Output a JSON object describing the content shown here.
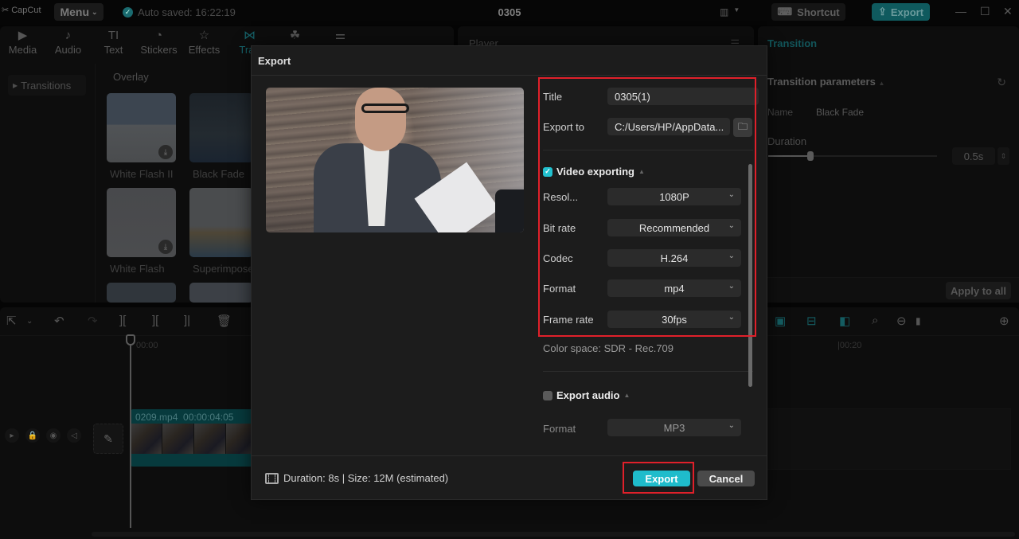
{
  "app": {
    "logo": "CapCut",
    "menu_label": "Menu",
    "autosave": "Auto saved: 16:22:19",
    "project_title": "0305",
    "shortcut_label": "Shortcut",
    "export_label": "Export",
    "accent_color": "#1fbccb"
  },
  "tool_tabs": [
    {
      "label": "Media",
      "icon": "media-icon"
    },
    {
      "label": "Audio",
      "icon": "audio-icon"
    },
    {
      "label": "Text",
      "icon": "text-icon"
    },
    {
      "label": "Stickers",
      "icon": "stickers-icon"
    },
    {
      "label": "Effects",
      "icon": "effects-icon"
    },
    {
      "label": "Tran",
      "icon": "transitions-icon",
      "active": true
    },
    {
      "label": "",
      "icon": "filters-icon"
    },
    {
      "label": "",
      "icon": "adjustment-icon"
    }
  ],
  "sidebar": {
    "item": "Transitions"
  },
  "library": {
    "section": "Overlay",
    "items": [
      {
        "label": "White Flash II"
      },
      {
        "label": "Black Fade"
      },
      {
        "label": "White Flash"
      },
      {
        "label": "Superimpose"
      }
    ]
  },
  "player": {
    "label": "Player"
  },
  "properties": {
    "tab": "Transition",
    "section": "Transition parameters",
    "name_label": "Name",
    "name_value": "Black Fade",
    "duration_label": "Duration",
    "duration_value": "0.5s",
    "duration_fraction": 0.25,
    "apply_all": "Apply to all"
  },
  "timeline": {
    "ruler_start": "00:00",
    "ruler_mark": "|00:20",
    "clip_name": "0209.mp4",
    "clip_duration": "00:00:04:05"
  },
  "export_dialog": {
    "title": "Export",
    "fields": {
      "title_label": "Title",
      "title_value": "0305(1)",
      "export_to_label": "Export to",
      "export_to_value": "C:/Users/HP/AppData..."
    },
    "video_section": {
      "label": "Video exporting",
      "checked": true,
      "settings": [
        {
          "label": "Resol...",
          "value": "1080P"
        },
        {
          "label": "Bit rate",
          "value": "Recommended"
        },
        {
          "label": "Codec",
          "value": "H.264"
        },
        {
          "label": "Format",
          "value": "mp4"
        },
        {
          "label": "Frame rate",
          "value": "30fps"
        }
      ],
      "color_space": "Color space: SDR - Rec.709"
    },
    "audio_section": {
      "label": "Export audio",
      "checked": false,
      "format_label": "Format",
      "format_value": "MP3"
    },
    "summary": "Duration: 8s | Size: 12M (estimated)",
    "export_button": "Export",
    "cancel_button": "Cancel"
  }
}
